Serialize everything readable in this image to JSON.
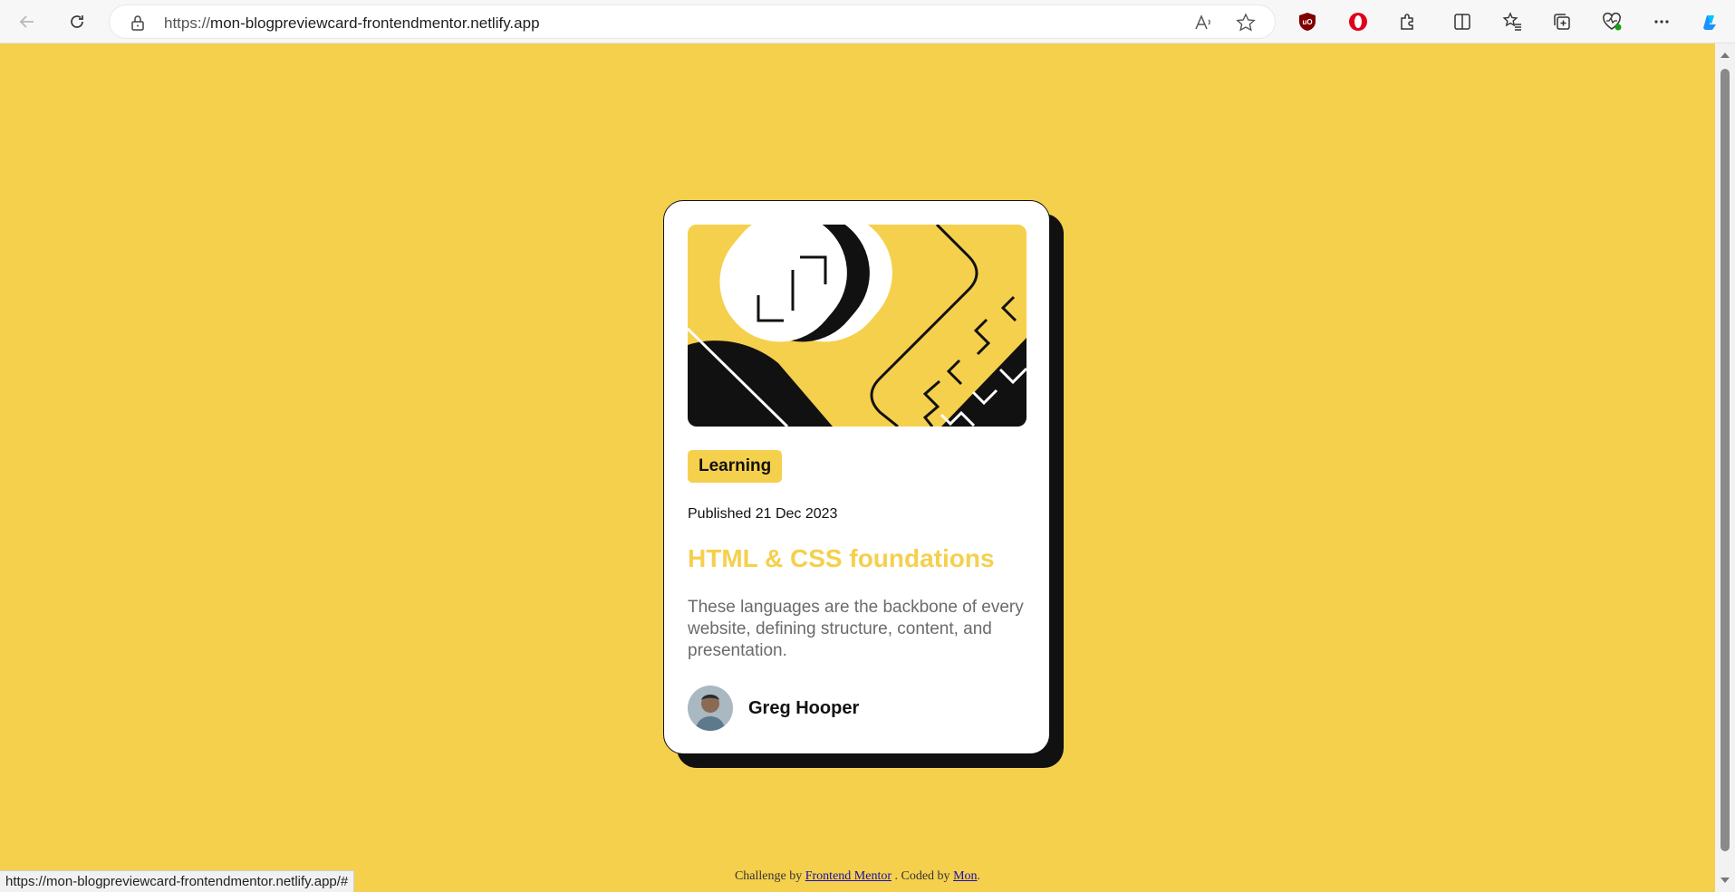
{
  "browser": {
    "url_protocol": "https://",
    "url_host": "mon-blogpreviewcard-frontendmentor.netlify.app",
    "status_url": "https://mon-blogpreviewcard-frontendmentor.netlify.app/#"
  },
  "card": {
    "tag": "Learning",
    "published": "Published 21 Dec 2023",
    "title": "HTML & CSS foundations",
    "description": "These languages are the backbone of every website, defining structure, content, and presentation.",
    "author": "Greg Hooper"
  },
  "footer": {
    "prefix": "Challenge by",
    "link1": "Frontend Mentor",
    "middle": ". Coded by",
    "link2": "Mon",
    "suffix": "."
  },
  "colors": {
    "background": "#f5d04d",
    "card": "#ffffff",
    "shadow": "#111111",
    "title": "#f5d04d"
  }
}
